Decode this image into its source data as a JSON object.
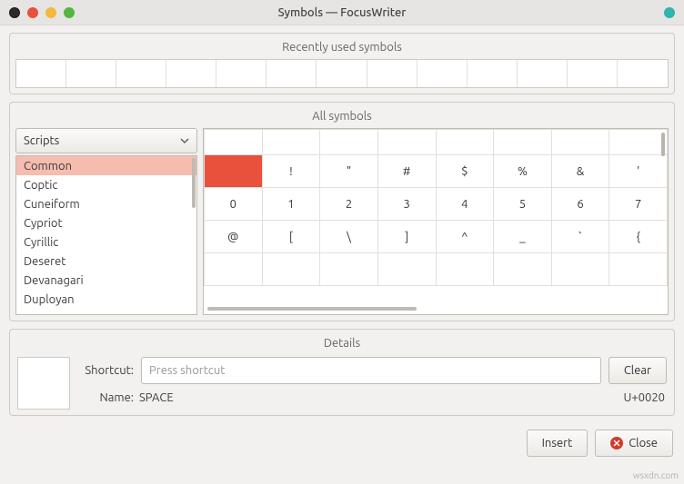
{
  "window": {
    "title": "Symbols — FocusWriter"
  },
  "sections": {
    "recent_title": "Recently used symbols",
    "all_title": "All symbols",
    "details_title": "Details"
  },
  "scripts_dropdown": {
    "label": "Scripts"
  },
  "script_list": {
    "items": [
      "Common",
      "Coptic",
      "Cuneiform",
      "Cypriot",
      "Cyrillic",
      "Deseret",
      "Devanagari",
      "Duployan"
    ],
    "selected_index": 0
  },
  "symbol_grid": {
    "rows": [
      [
        "",
        "",
        "",
        "",
        "",
        "",
        "",
        ""
      ],
      [
        "",
        "!",
        "\"",
        "#",
        "$",
        "%",
        "&",
        "'"
      ],
      [
        "0",
        "1",
        "2",
        "3",
        "4",
        "5",
        "6",
        "7"
      ],
      [
        "@",
        "[",
        "\\",
        "]",
        "^",
        "_",
        "`",
        "{"
      ],
      [
        "",
        "",
        "",
        "",
        "",
        "",
        "",
        ""
      ]
    ],
    "selected": {
      "row": 1,
      "col": 0
    }
  },
  "details": {
    "shortcut_label": "Shortcut:",
    "shortcut_placeholder": "Press shortcut",
    "clear_label": "Clear",
    "name_label": "Name:",
    "name_value": "SPACE",
    "code_value": "U+0020"
  },
  "buttons": {
    "insert": "Insert",
    "close": "Close"
  },
  "watermark": "wsxdn.com"
}
